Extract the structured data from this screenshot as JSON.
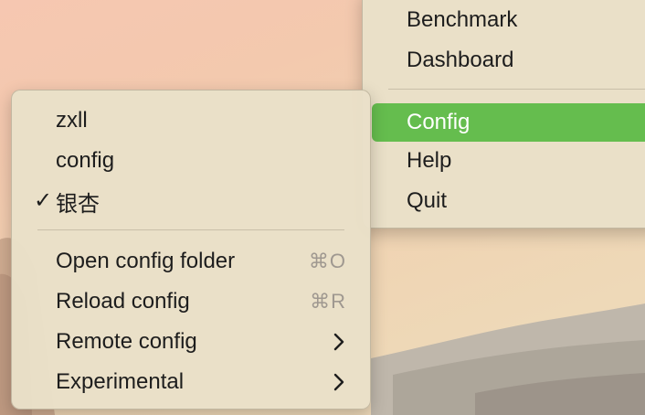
{
  "colors": {
    "selection": "#65bd4e",
    "menu_bg": "#e9e0c8",
    "shortcut": "#9f9890"
  },
  "main_menu": {
    "items": [
      {
        "label": "Benchmark"
      },
      {
        "label": "Dashboard"
      },
      {
        "label": "Config",
        "selected": true
      },
      {
        "label": "Help"
      },
      {
        "label": "Quit"
      }
    ]
  },
  "config_menu": {
    "profiles": [
      {
        "label": "zxll",
        "checked": false
      },
      {
        "label": "config",
        "checked": false
      },
      {
        "label": "银杏",
        "checked": true,
        "check_glyph": "✓"
      }
    ],
    "actions": [
      {
        "label": "Open config folder",
        "shortcut": "⌘O"
      },
      {
        "label": "Reload config",
        "shortcut": "⌘R"
      },
      {
        "label": "Remote config",
        "submenu": true,
        "icon": "chevron-right-icon"
      },
      {
        "label": "Experimental",
        "submenu": true,
        "icon": "chevron-right-icon"
      }
    ]
  }
}
